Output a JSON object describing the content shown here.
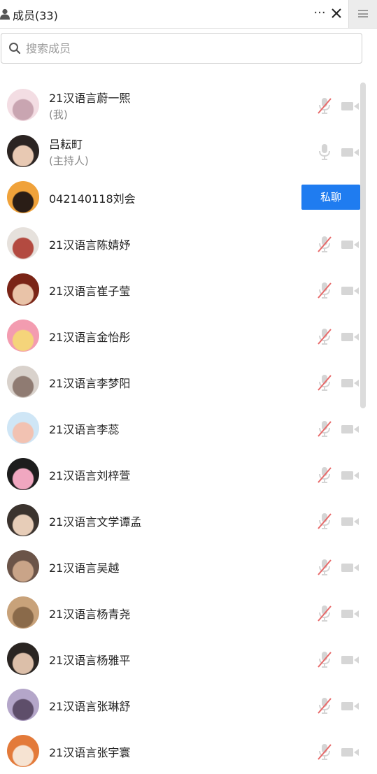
{
  "header": {
    "title": "成员(33)",
    "more_label": "···",
    "icons": [
      "people-icon",
      "more-icon",
      "close-icon",
      "menu-icon"
    ]
  },
  "search": {
    "placeholder": "搜索成员",
    "value": ""
  },
  "members": [
    {
      "name": "21汉语言蔚一熙",
      "sub": "(我)",
      "mic": "muted",
      "camera": "off",
      "avatar_colors": [
        "#f3dde3",
        "#c9a5b1"
      ]
    },
    {
      "name": "吕耘町",
      "sub": "(主持人)",
      "mic": "on",
      "camera": "off",
      "avatar_colors": [
        "#2b2422",
        "#e8c9b3"
      ]
    },
    {
      "name": "042140118刘会",
      "sub": "",
      "mic": "hidden",
      "camera": "hidden",
      "action_label": "私聊",
      "avatar_colors": [
        "#f0a23a",
        "#2a1d16"
      ]
    },
    {
      "name": "21汉语言陈婧妤",
      "sub": "",
      "mic": "muted",
      "camera": "off",
      "avatar_colors": [
        "#e6e1dc",
        "#b34a40"
      ]
    },
    {
      "name": "21汉语言崔子莹",
      "sub": "",
      "mic": "muted",
      "camera": "off",
      "avatar_colors": [
        "#7a2416",
        "#e9c3a8"
      ]
    },
    {
      "name": "21汉语言金怡彤",
      "sub": "",
      "mic": "muted",
      "camera": "off",
      "avatar_colors": [
        "#f39cb0",
        "#f5d47a"
      ]
    },
    {
      "name": "21汉语言李梦阳",
      "sub": "",
      "mic": "muted",
      "camera": "off",
      "avatar_colors": [
        "#d9d2cc",
        "#8f7b72"
      ]
    },
    {
      "name": "21汉语言李蕊",
      "sub": "",
      "mic": "muted",
      "camera": "off",
      "avatar_colors": [
        "#cfe6f6",
        "#f2c2b2"
      ]
    },
    {
      "name": "21汉语言刘梓萱",
      "sub": "",
      "mic": "muted",
      "camera": "off",
      "avatar_colors": [
        "#1d1d1d",
        "#f0a7c0"
      ]
    },
    {
      "name": "21汉语言文学谭孟",
      "sub": "",
      "mic": "muted",
      "camera": "off",
      "avatar_colors": [
        "#3b332e",
        "#e7cdb8"
      ]
    },
    {
      "name": "21汉语言吴越",
      "sub": "",
      "mic": "muted",
      "camera": "off",
      "avatar_colors": [
        "#6b5448",
        "#c9a488"
      ]
    },
    {
      "name": "21汉语言杨青尧",
      "sub": "",
      "mic": "muted",
      "camera": "off",
      "avatar_colors": [
        "#c8a27a",
        "#8a6a4a"
      ]
    },
    {
      "name": "21汉语言杨雅平",
      "sub": "",
      "mic": "muted",
      "camera": "off",
      "avatar_colors": [
        "#2a2522",
        "#dcbfa9"
      ]
    },
    {
      "name": "21汉语言张琳舒",
      "sub": "",
      "mic": "muted",
      "camera": "off",
      "avatar_colors": [
        "#b4a6c9",
        "#5e4e6a"
      ]
    },
    {
      "name": "21汉语言张宇寰",
      "sub": "",
      "mic": "muted",
      "camera": "off",
      "avatar_colors": [
        "#e37a3a",
        "#f6e3d2"
      ]
    }
  ],
  "colors": {
    "accent": "#1f7cf0",
    "icon_gray": "#cfcfcf",
    "mute_slash": "#e86a6a"
  }
}
